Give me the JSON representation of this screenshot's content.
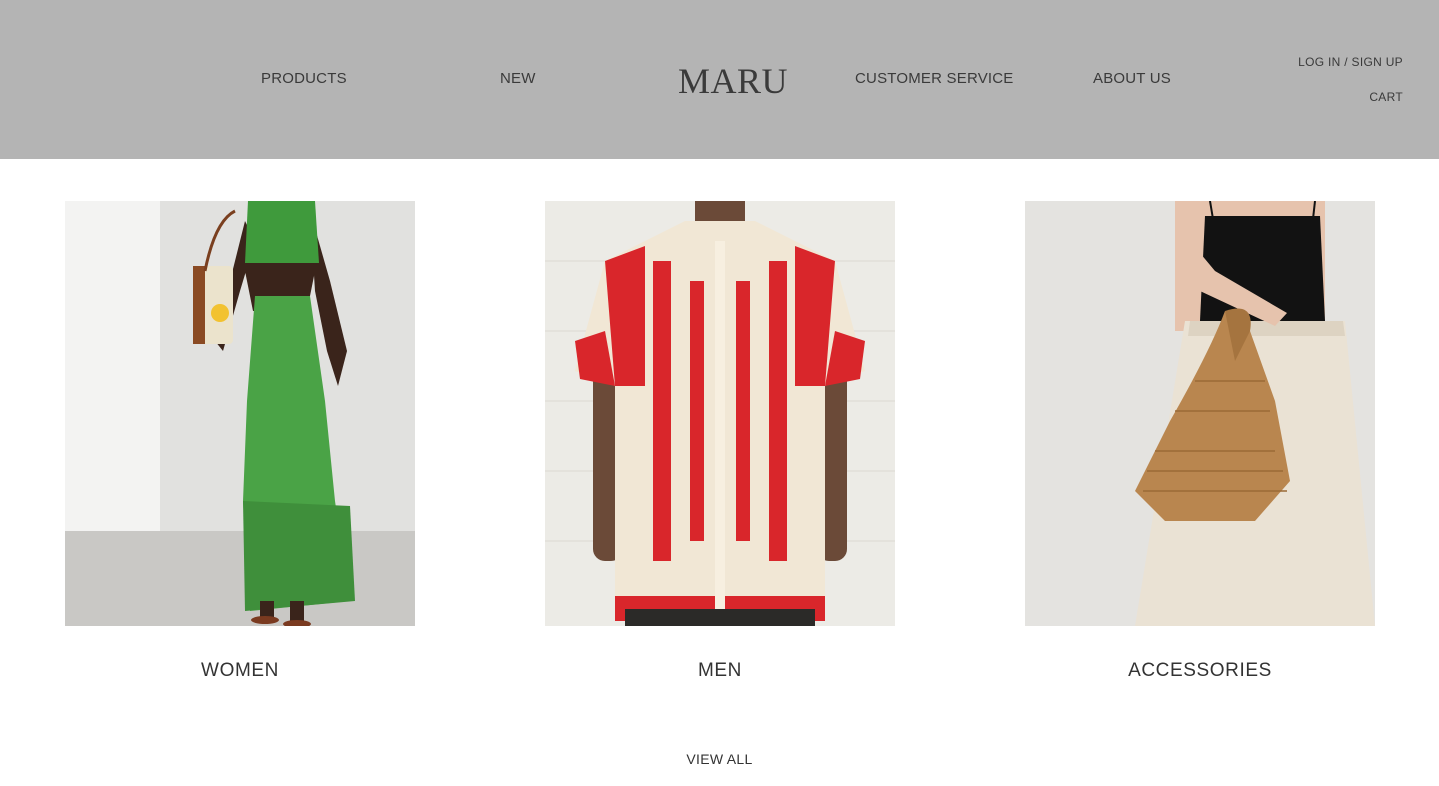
{
  "header": {
    "logo": "MARU",
    "nav": {
      "products": "PRODUCTS",
      "new": "NEW",
      "customer_service": "CUSTOMER SERVICE",
      "about_us": "ABOUT US"
    },
    "account": {
      "login_signup": "LOG IN / SIGN UP",
      "cart": "CART"
    },
    "background_color": "#b4b4b4"
  },
  "categories": [
    {
      "label": "WOMEN",
      "image": "woman in green crochet maxi skirt and crop top with straw bag"
    },
    {
      "label": "MEN",
      "image": "man in red and cream striped crochet short-sleeve shirt"
    },
    {
      "label": "ACCESSORIES",
      "image": "woman holding tan knitted knot bag, black top and cream skirt"
    }
  ],
  "view_all": "VIEW ALL"
}
